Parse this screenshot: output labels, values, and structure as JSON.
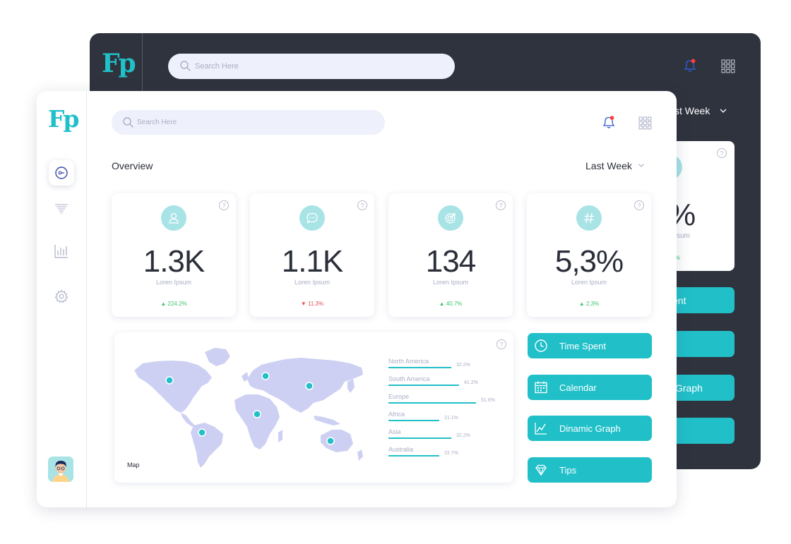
{
  "colors": {
    "accent": "#21c0c9",
    "accent_light": "#a8e3e6",
    "dark_panel": "#2f333d",
    "search_bg": "#eef0fb",
    "up": "#3ec46d",
    "down": "#e94e57"
  },
  "back_window": {
    "logo": "Fp",
    "search_placeholder": "Search Here",
    "period_label": "st Week",
    "stat_value": "%",
    "stat_label": "sum",
    "stat_change": "%",
    "buttons": [
      "ent",
      "",
      "Graph",
      ""
    ]
  },
  "front_window": {
    "logo": "Fp",
    "search_placeholder": "Search Here",
    "nav_icons": [
      "dashboard-icon",
      "filter-icon",
      "bar-chart-icon",
      "settings-icon"
    ],
    "overview_title": "Overview",
    "period": "Last Week",
    "stats": [
      {
        "icon": "user-icon",
        "value": "1.3K",
        "label": "Loren Ipsum",
        "change": "224.2%",
        "direction": "up"
      },
      {
        "icon": "chat-icon",
        "value": "1.1K",
        "label": "Loren Ipsum",
        "change": "11.3%",
        "direction": "down"
      },
      {
        "icon": "target-icon",
        "value": "134",
        "label": "Loren Ipsum",
        "change": "40.7%",
        "direction": "up"
      },
      {
        "icon": "hashtag-icon",
        "value": "5,3%",
        "label": "Loren Ipsum",
        "change": "2,3%",
        "direction": "up"
      }
    ],
    "map": {
      "label": "Map",
      "regions": [
        {
          "name": "North America",
          "percent": "32.2%"
        },
        {
          "name": "South America",
          "percent": "41.2%"
        },
        {
          "name": "Europe",
          "percent": "51.6%"
        },
        {
          "name": "Africa",
          "percent": "21.1%"
        },
        {
          "name": "Asia",
          "percent": "32.2%"
        },
        {
          "name": "Australia",
          "percent": "22.7%"
        }
      ]
    },
    "actions": [
      {
        "icon": "clock-icon",
        "label": "Time Spent"
      },
      {
        "icon": "calendar-icon",
        "label": "Calendar"
      },
      {
        "icon": "line-graph-icon",
        "label": "Dinamic Graph"
      },
      {
        "icon": "diamond-icon",
        "label": "Tips"
      }
    ]
  }
}
